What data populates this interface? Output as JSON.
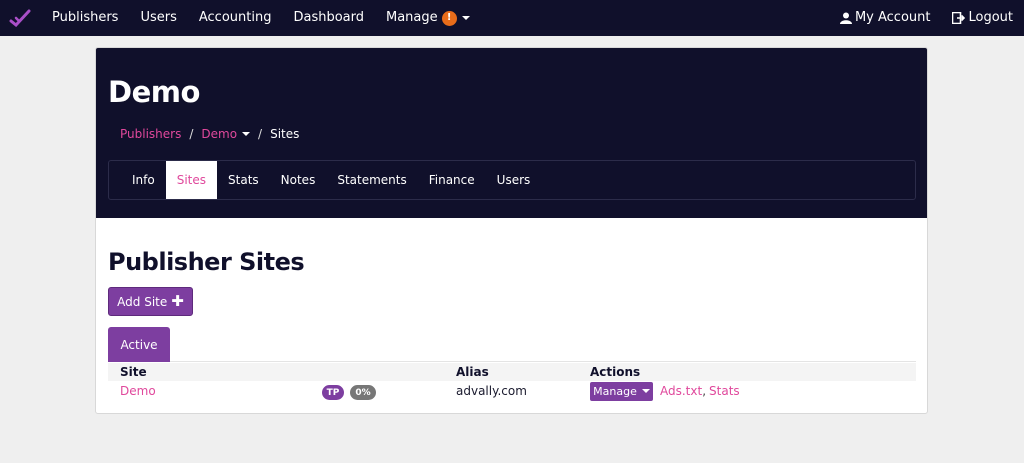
{
  "nav": {
    "items": [
      {
        "label": "Publishers"
      },
      {
        "label": "Users"
      },
      {
        "label": "Accounting"
      },
      {
        "label": "Dashboard"
      },
      {
        "label": "Manage",
        "badge": "!"
      }
    ],
    "my_account": "My Account",
    "logout": "Logout"
  },
  "header": {
    "title": "Demo",
    "breadcrumb": {
      "publishers": "Publishers",
      "demo": "Demo",
      "current": "Sites"
    },
    "tabs": [
      "Info",
      "Sites",
      "Stats",
      "Notes",
      "Statements",
      "Finance",
      "Users"
    ],
    "active_tab": "Sites"
  },
  "main": {
    "section_title": "Publisher Sites",
    "add_site_label": "Add Site",
    "status_tab": "Active",
    "columns": [
      "Site",
      "Alias",
      "Actions"
    ],
    "rows": [
      {
        "site": "Demo",
        "tp_badge": "TP",
        "pct_badge": "0%",
        "alias": "advally.com",
        "manage_label": "Manage",
        "link_ads": "Ads.txt",
        "link_stats": "Stats"
      }
    ]
  },
  "colors": {
    "navy": "#10102b",
    "purple": "#7d3ea0",
    "pink": "#e0489c",
    "orange": "#e86c1a"
  }
}
